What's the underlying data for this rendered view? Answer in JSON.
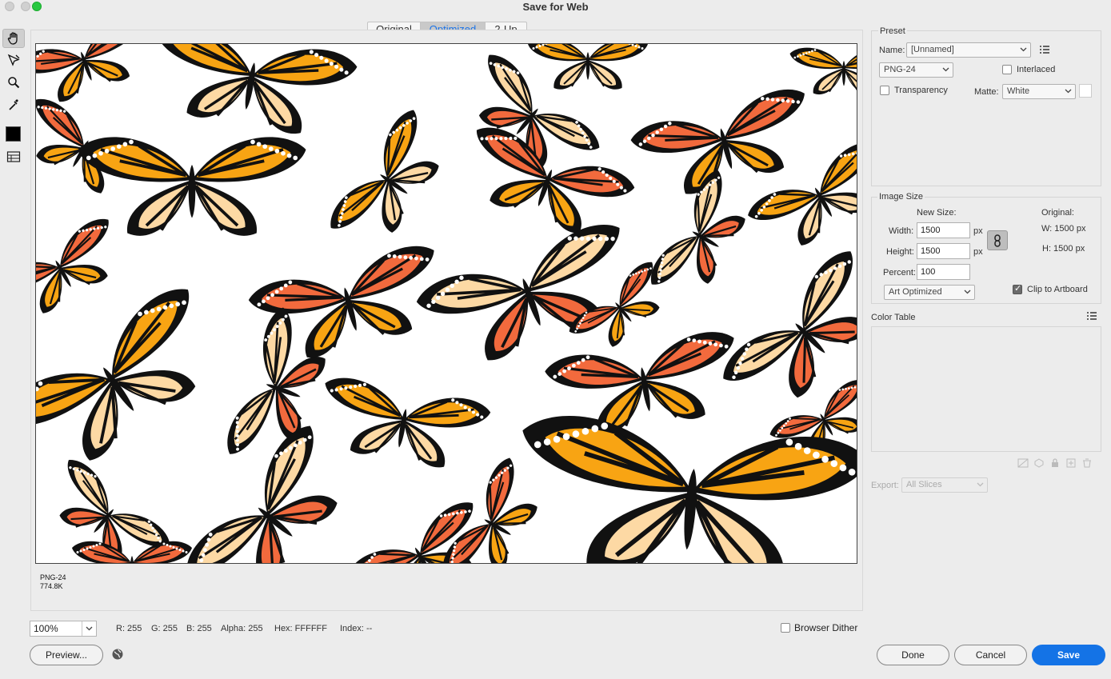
{
  "window": {
    "title": "Save for Web"
  },
  "view_tabs": [
    {
      "label": "Original",
      "active": false
    },
    {
      "label": "Optimized",
      "active": true
    },
    {
      "label": "2-Up",
      "active": false
    }
  ],
  "tools": [
    "hand-icon",
    "slice-select-icon",
    "zoom-icon",
    "eyedropper-icon",
    "color-swatch",
    "slice-visibility-icon"
  ],
  "image_info": {
    "format": "PNG-24",
    "size": "774.8K"
  },
  "bottom_bar": {
    "zoom": "100%",
    "r": "R: 255",
    "g": "G: 255",
    "b": "B: 255",
    "alpha": "Alpha: 255",
    "hex": "Hex: FFFFFF",
    "index": "Index: --",
    "browser_dither_label": "Browser Dither",
    "browser_dither_checked": false
  },
  "buttons": {
    "preview": "Preview...",
    "done": "Done",
    "cancel": "Cancel",
    "save": "Save"
  },
  "preset": {
    "section_title": "Preset",
    "name_label": "Name:",
    "name_value": "[Unnamed]",
    "format_value": "PNG-24",
    "interlaced_label": "Interlaced",
    "interlaced_checked": false,
    "transparency_label": "Transparency",
    "transparency_checked": false,
    "matte_label": "Matte:",
    "matte_value": "White"
  },
  "image_size": {
    "section_title": "Image Size",
    "new_size_label": "New Size:",
    "width_label": "Width:",
    "width_value": "1500",
    "height_label": "Height:",
    "height_value": "1500",
    "unit": "px",
    "percent_label": "Percent:",
    "percent_value": "100",
    "quality_value": "Art Optimized",
    "original_label": "Original:",
    "orig_w": "W:  1500 px",
    "orig_h": "H:  1500 px",
    "clip_label": "Clip to Artboard",
    "clip_checked": true
  },
  "color_table": {
    "section_title": "Color Table"
  },
  "export": {
    "label": "Export:",
    "value": "All Slices"
  },
  "colors": {
    "accent": "#1473e6",
    "monarch_orange": "#f26a3d",
    "monarch_yellow": "#f8a413",
    "monarch_pale": "#fdd9a4",
    "wing_black": "#111111"
  }
}
